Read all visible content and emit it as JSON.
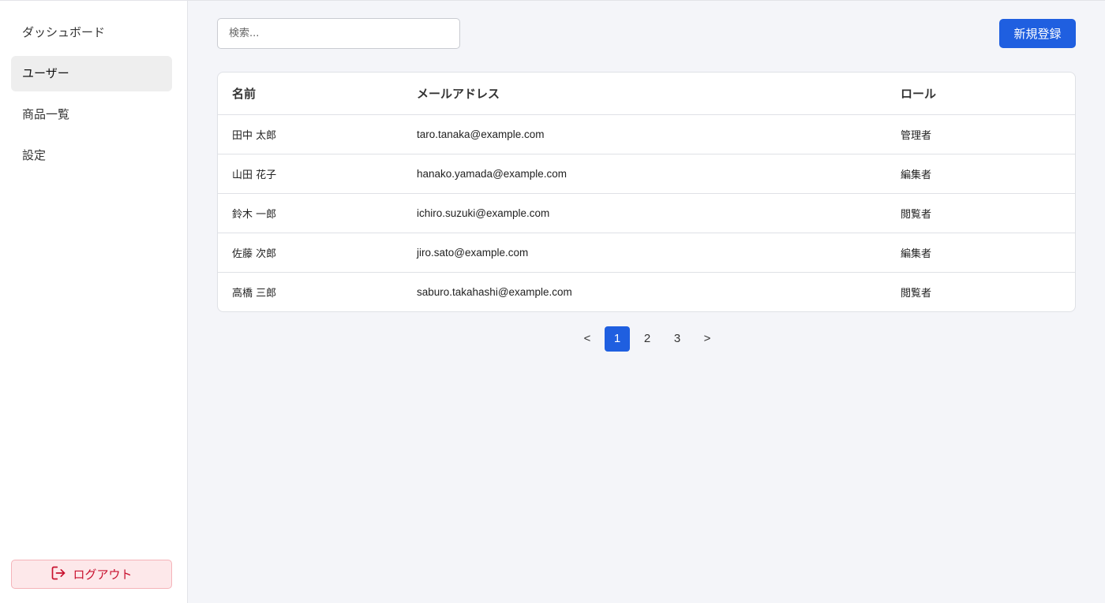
{
  "sidebar": {
    "items": [
      {
        "label": "ダッシュボード",
        "active": false
      },
      {
        "label": "ユーザー",
        "active": true
      },
      {
        "label": "商品一覧",
        "active": false
      },
      {
        "label": "設定",
        "active": false
      }
    ],
    "logout_label": "ログアウト",
    "logout_icon": "logout-icon"
  },
  "toolbar": {
    "search_placeholder": "検索...",
    "new_button_label": "新規登録"
  },
  "table": {
    "columns": [
      "名前",
      "メールアドレス",
      "ロール"
    ],
    "rows": [
      [
        "田中 太郎",
        "taro.tanaka@example.com",
        "管理者"
      ],
      [
        "山田 花子",
        "hanako.yamada@example.com",
        "編集者"
      ],
      [
        "鈴木 一郎",
        "ichiro.suzuki@example.com",
        "閲覧者"
      ],
      [
        "佐藤 次郎",
        "jiro.sato@example.com",
        "編集者"
      ],
      [
        "高橋 三郎",
        "saburo.takahashi@example.com",
        "閲覧者"
      ]
    ]
  },
  "pagination": {
    "prev": "<",
    "pages": [
      "1",
      "2",
      "3"
    ],
    "current": "1",
    "next": ">"
  },
  "colors": {
    "accent": "#1f5fe0",
    "danger": "#c8102e",
    "danger_bg": "#fde8ea"
  }
}
